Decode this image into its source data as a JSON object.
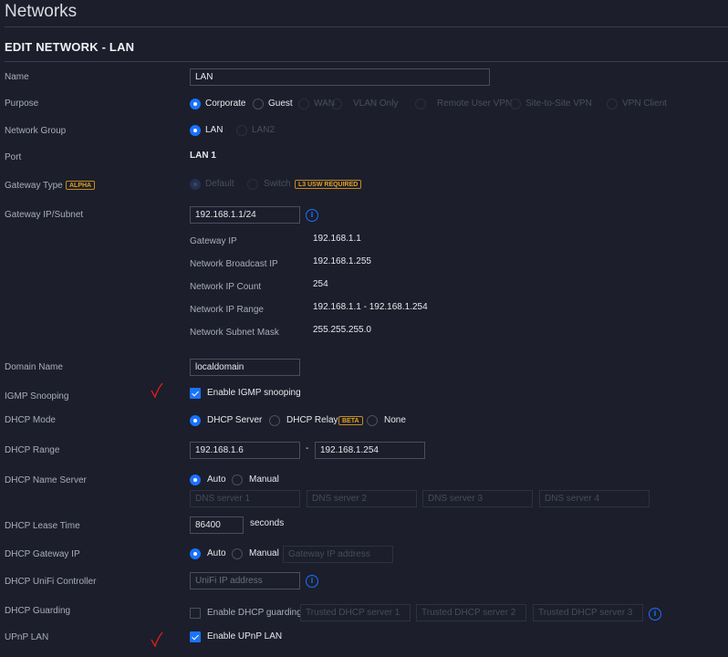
{
  "page": {
    "title": "Networks",
    "section": "EDIT NETWORK - LAN"
  },
  "colors": {
    "background": "#1c1e2b",
    "accent": "#1a73ff",
    "badge": "#e0a227",
    "annotation": "#e0201a"
  },
  "form": {
    "name": {
      "label": "Name",
      "value": "LAN"
    },
    "purpose": {
      "label": "Purpose",
      "selected": "Corporate",
      "options": [
        "Corporate",
        "Guest",
        "WAN",
        "VLAN Only",
        "Remote User VPN",
        "Site-to-Site VPN",
        "VPN Client"
      ]
    },
    "network_group": {
      "label": "Network Group",
      "selected": "LAN",
      "options": [
        "LAN",
        "LAN2"
      ]
    },
    "port": {
      "label": "Port",
      "value": "LAN 1"
    },
    "gateway_type": {
      "label": "Gateway Type",
      "badge": "ALPHA",
      "selected": "Default",
      "options": [
        "Default",
        "Switch"
      ],
      "switch_badge": "L3 USW REQUIRED"
    },
    "gateway_subnet": {
      "label": "Gateway IP/Subnet",
      "value": "192.168.1.1/24",
      "info_icon": "info-icon"
    },
    "subnet_info": [
      {
        "label": "Gateway IP",
        "value": "192.168.1.1"
      },
      {
        "label": "Network Broadcast IP",
        "value": "192.168.1.255"
      },
      {
        "label": "Network IP Count",
        "value": "254"
      },
      {
        "label": "Network IP Range",
        "value": "192.168.1.1 - 192.168.1.254"
      },
      {
        "label": "Network Subnet Mask",
        "value": "255.255.255.0"
      }
    ],
    "domain_name": {
      "label": "Domain Name",
      "value": "localdomain"
    },
    "igmp": {
      "label": "IGMP Snooping",
      "checkbox": "Enable IGMP snooping",
      "checked": true
    },
    "dhcp_mode": {
      "label": "DHCP Mode",
      "selected": "DHCP Server",
      "options": [
        "DHCP Server",
        "DHCP Relay",
        "None"
      ],
      "relay_badge": "BETA"
    },
    "dhcp_range": {
      "label": "DHCP Range",
      "start": "192.168.1.6",
      "separator": "-",
      "end": "192.168.1.254"
    },
    "dhcp_name_server": {
      "label": "DHCP Name Server",
      "selected": "Auto",
      "options": [
        "Auto",
        "Manual"
      ],
      "placeholders": [
        "DNS server 1",
        "DNS server 2",
        "DNS server 3",
        "DNS server 4"
      ]
    },
    "lease_time": {
      "label": "DHCP Lease Time",
      "value": "86400",
      "unit": "seconds"
    },
    "dhcp_gateway": {
      "label": "DHCP Gateway IP",
      "selected": "Auto",
      "options": [
        "Auto",
        "Manual"
      ],
      "placeholder": "Gateway IP address"
    },
    "unifi_controller": {
      "label": "DHCP UniFi Controller",
      "placeholder": "UniFi IP address"
    },
    "dhcp_guarding": {
      "label": "DHCP Guarding",
      "checkbox": "Enable DHCP guarding",
      "checked": false,
      "placeholders": [
        "Trusted DHCP server 1",
        "Trusted DHCP server 2",
        "Trusted DHCP server 3"
      ]
    },
    "upnp": {
      "label": "UPnP LAN",
      "checkbox": "Enable UPnP LAN",
      "checked": true
    }
  }
}
